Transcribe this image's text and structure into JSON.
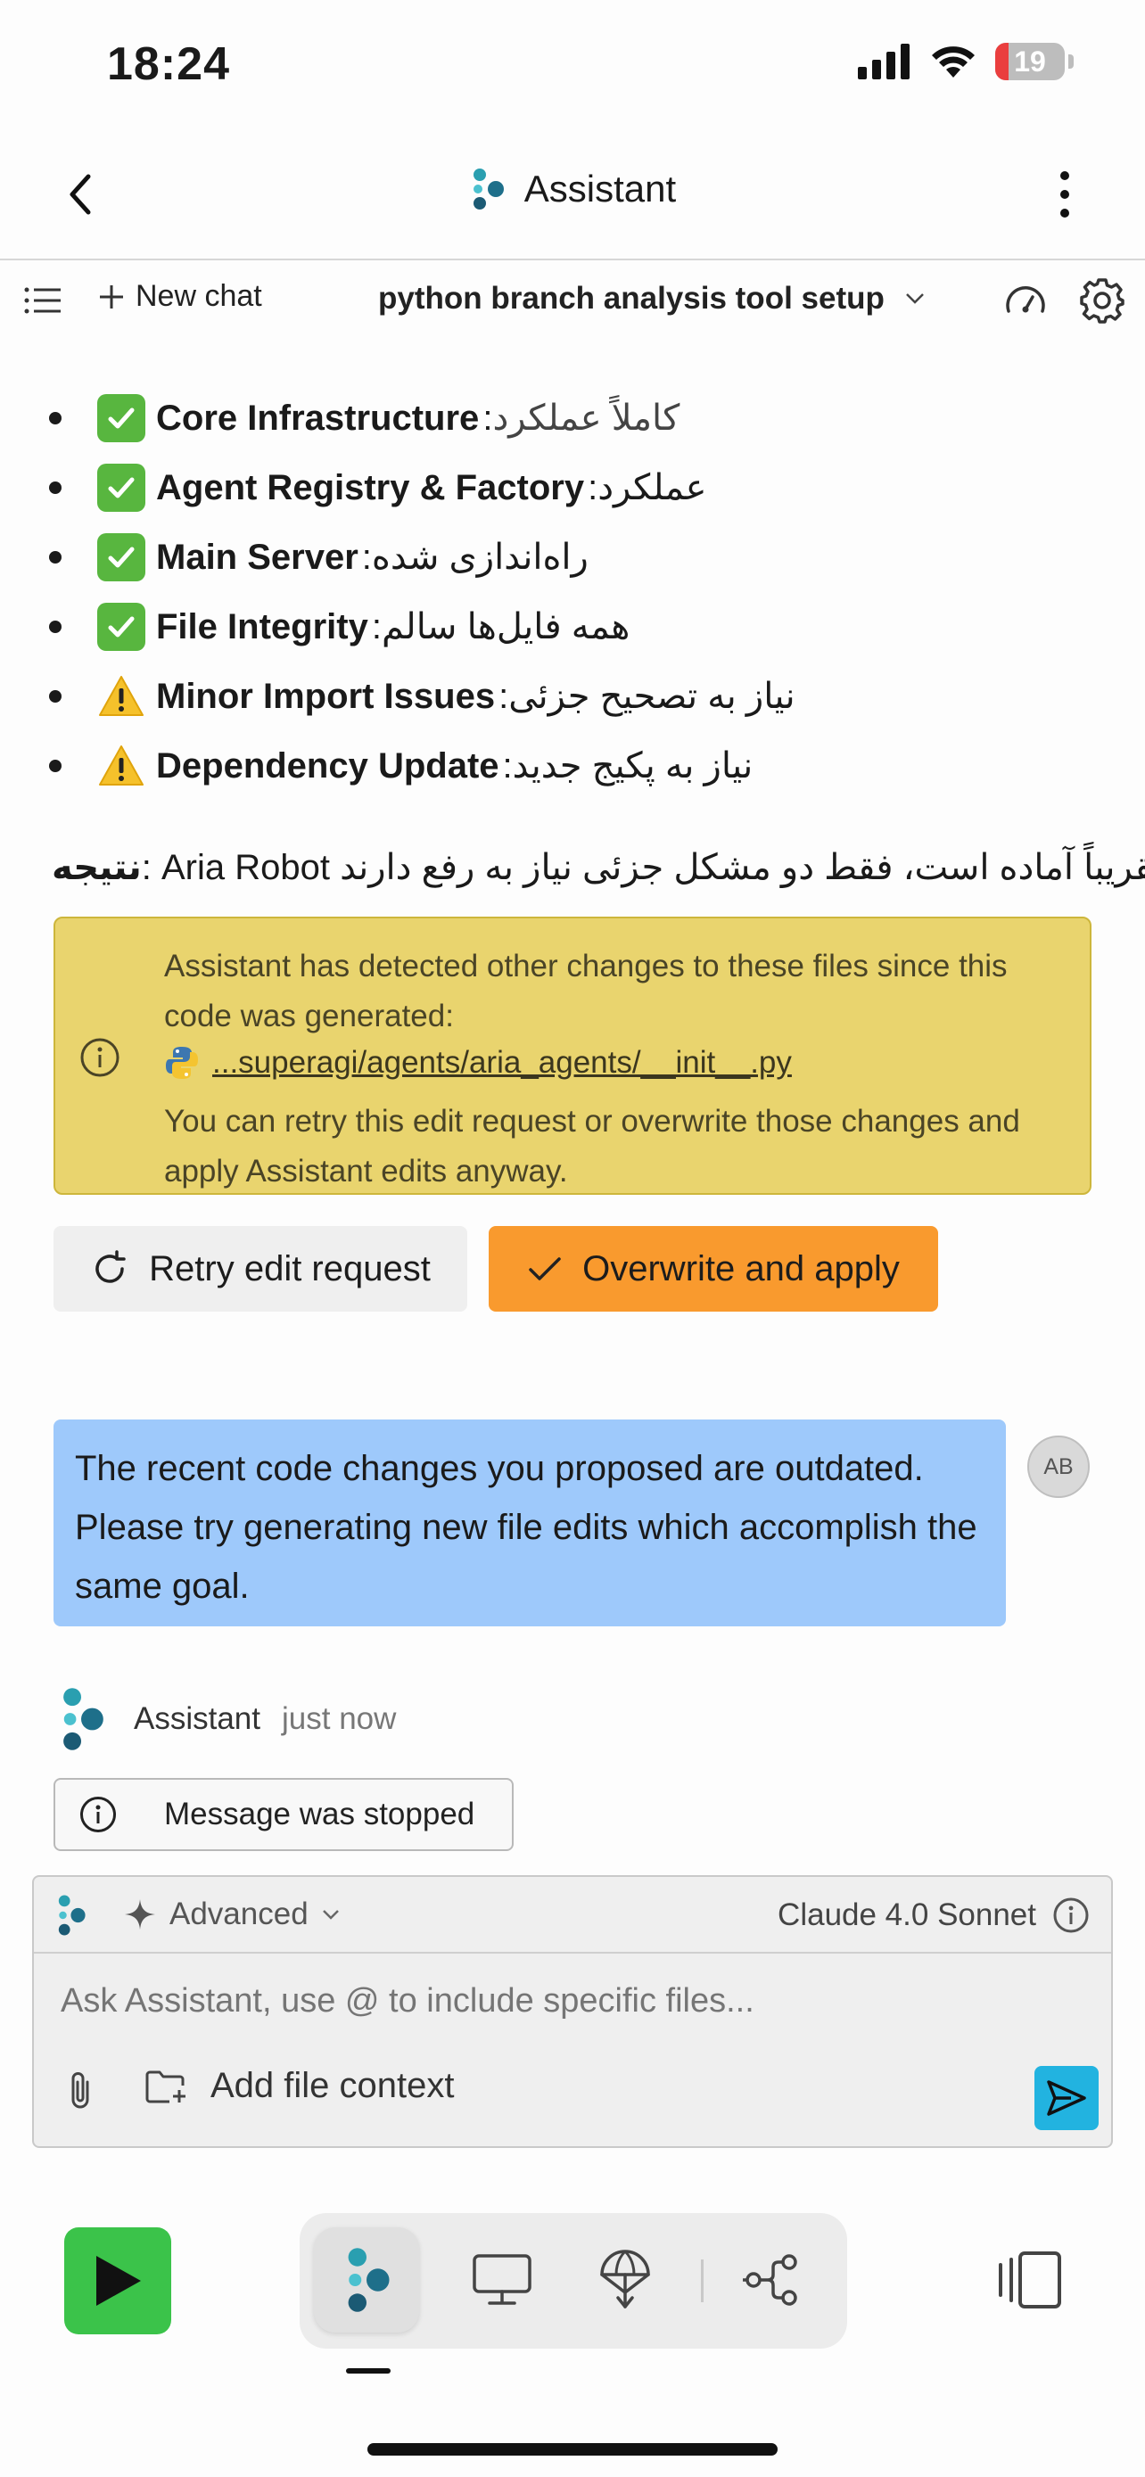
{
  "status_bar": {
    "time": "18:24",
    "battery": "19"
  },
  "header": {
    "title": "Assistant"
  },
  "toolbar": {
    "new_chat": "New chat",
    "chat_title": "python branch analysis tool setup"
  },
  "status_items": [
    {
      "icon": "check",
      "label": "Core Infrastructure",
      "value": "کاملاً عملکرد"
    },
    {
      "icon": "check",
      "label": "Agent Registry & Factory",
      "value": "عملکرد"
    },
    {
      "icon": "check",
      "label": "Main Server",
      "value": "راه‌اندازی شده"
    },
    {
      "icon": "check",
      "label": "File Integrity",
      "value": "همه فایل‌ها سالم"
    },
    {
      "icon": "warning",
      "label": "Minor Import Issues",
      "value": "نیاز به تصحیح جزئی"
    },
    {
      "icon": "warning",
      "label": "Dependency Update",
      "value": "نیاز به پکیج جدید"
    }
  ],
  "result": {
    "label": "نتیجه",
    "text": "Aria Robot تقریباً آماده است، فقط دو مشکل جزئی نیاز به رفع دارند."
  },
  "notice": {
    "line1": "Assistant has detected other changes to these files since this code was generated:",
    "file": "...superagi/agents/aria_agents/__init__.py",
    "line2": "You can retry this edit request or overwrite those changes and apply Assistant edits anyway."
  },
  "buttons": {
    "retry": "Retry edit request",
    "overwrite": "Overwrite and apply"
  },
  "user_message": {
    "text": "The recent code changes you proposed are outdated. Please try generating new file edits which accomplish the same goal.",
    "avatar": "AB"
  },
  "assistant": {
    "name": "Assistant",
    "time": "just now",
    "stopped": "Message was stopped"
  },
  "composer": {
    "mode": "Advanced",
    "model": "Claude 4.0 Sonnet",
    "placeholder": "Ask Assistant, use @ to include specific files...",
    "add_context": "Add file context"
  },
  "colors": {
    "accent_orange": "#f99a2e",
    "user_bubble": "#9ec9fb",
    "notice_yellow": "#e9d46e",
    "send_blue": "#22b3e0",
    "play_green": "#3bc34a"
  }
}
